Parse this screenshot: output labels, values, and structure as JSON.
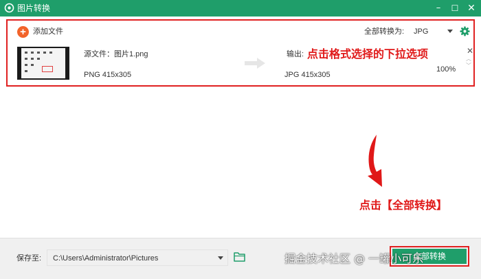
{
  "window": {
    "title": "图片转换",
    "minimize_glyph": "–",
    "maximize_glyph": "☐",
    "close_glyph": "✕"
  },
  "toolbar": {
    "add_file_label": "添加文件",
    "convert_all_to_label": "全部转换为:",
    "format_value": "JPG"
  },
  "file_row": {
    "source_label": "源文件：图片1.png",
    "source_info": "PNG  415x305",
    "output_label": "输出:",
    "output_info": "JPG  415x305",
    "progress": "100%"
  },
  "annotations": {
    "top": "点击格式选择的下拉选项",
    "bottom": "点击【全部转换】"
  },
  "footer": {
    "save_to_label": "保存至:",
    "save_path": "C:\\Users\\Administrator\\Pictures",
    "convert_all_button": "全部转换",
    "watermark": "掘金技术社区 @ 一罐小可乐"
  },
  "colors": {
    "accent": "#1f9e6a",
    "annotation_red": "#e01818",
    "add_icon_orange": "#f2632a"
  },
  "icons": [
    "app-icon",
    "plus-icon",
    "gear-icon",
    "arrow-right-icon",
    "close-icon",
    "chevron-up-icon",
    "chevron-down-icon",
    "folder-icon"
  ]
}
